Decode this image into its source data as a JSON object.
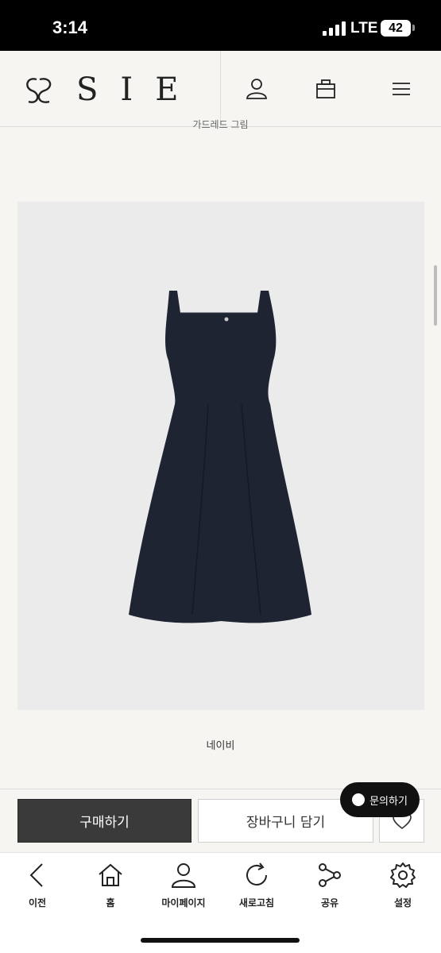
{
  "status_bar": {
    "time": "3:14",
    "network": "LTE",
    "battery": "42"
  },
  "header": {
    "brand": "SIE",
    "icons": [
      "user-icon",
      "bag-icon",
      "menu-icon"
    ]
  },
  "caption_top": "가드레드 그림",
  "product": {
    "color_label": "네이비",
    "dress_color": "#1f2433"
  },
  "purchase": {
    "buy_label": "구매하기",
    "cart_label": "장바구니 담기",
    "inquiry_label": "문의하기"
  },
  "bottom_nav": {
    "items": [
      {
        "label": "이전",
        "icon": "chevron-left-icon"
      },
      {
        "label": "홈",
        "icon": "home-icon"
      },
      {
        "label": "마이페이지",
        "icon": "person-icon"
      },
      {
        "label": "새로고침",
        "icon": "refresh-icon"
      },
      {
        "label": "공유",
        "icon": "share-icon"
      },
      {
        "label": "설정",
        "icon": "gear-icon"
      }
    ]
  }
}
